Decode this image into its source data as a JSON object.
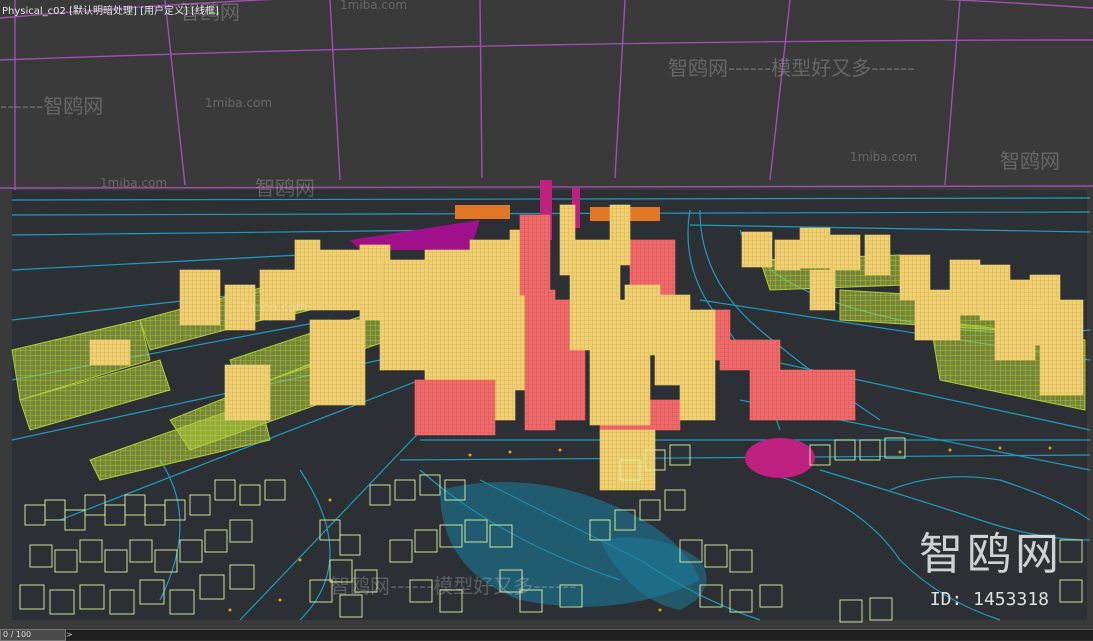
{
  "viewport": {
    "label_prefix": "Physical_c02",
    "label_shading": "[默认明暗处理]",
    "label_view": "[用户定义]",
    "label_mode": "[线框]"
  },
  "watermarks": {
    "site": "1miba.com",
    "brand_line": "智鸥网------模型好又多------",
    "brand_short": "------智鸥网",
    "brand_mid": "智鸥网",
    "logo": "智鸥网",
    "id": "ID: 1453318"
  },
  "timebar": {
    "frame": "0 / 100",
    "arrow": ">"
  },
  "colors": {
    "background": "#3a3a3a",
    "grid": "#a050b0",
    "roads": "#1fa0c0",
    "tower_yellow": "#f0d070",
    "tower_red": "#f06a6a",
    "block_green": "#b0cc3a",
    "house_pale": "#d9f3a8",
    "magenta": "#c02080",
    "orange": "#e07828"
  }
}
